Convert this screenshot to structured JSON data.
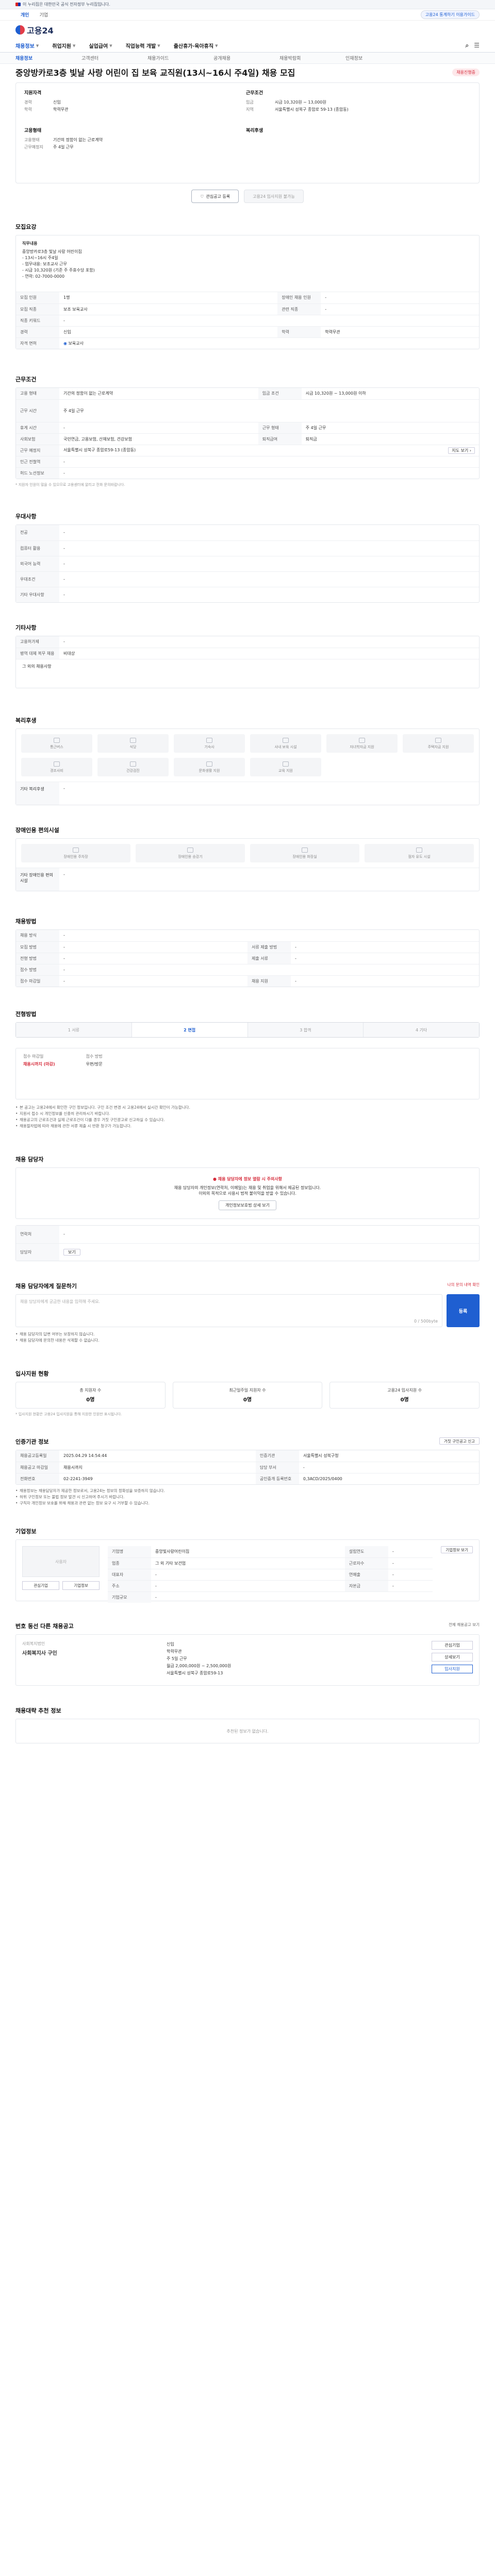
{
  "gov_strip": "이 누리집은 대한민국 공식 전자정부 누리집입니다.",
  "util": {
    "tabs": [
      "개인",
      "기업"
    ],
    "right": [
      "고용24 통계하기 이용가이드"
    ]
  },
  "header": {
    "logo_text": "고용24"
  },
  "gnb": {
    "items": [
      "채용정보",
      "취업지원",
      "실업급여",
      "직업능력 개발",
      "출산휴가·육아휴직"
    ],
    "active": 0
  },
  "subnav": [
    "채용정보",
    "고객센터",
    "채용가이드",
    "공개채용",
    "채용박람회",
    "인재정보"
  ],
  "title": "중앙방카로3층 빛날 사랑 어린이 집 보육 교직원(13시~16시 주4일) 채용 모집",
  "title_badge": "채용진행중",
  "summary": {
    "left_title": "지원자격",
    "left": [
      {
        "k": "경력",
        "v": "신입"
      },
      {
        "k": "학력",
        "v": "학력무관"
      }
    ],
    "left2_title": "고용형태",
    "left2": [
      {
        "k": "고용형태",
        "v": "기간의 정함이 없는 근로계약"
      },
      {
        "k": "근무예정지",
        "v": "주 4일 근무"
      }
    ],
    "right_title": "근무조건",
    "right": [
      {
        "k": "임금",
        "v": "시급 10,320원 ~ 13,000원"
      },
      {
        "k": "지역",
        "v": "서울특별시 성북구 종암로 59-13 (종암동)"
      }
    ],
    "right2_title": "복리후생",
    "right2": []
  },
  "buttons": {
    "save": "관심공고 등록",
    "apply": "고용24 입사지원 불가능"
  },
  "sec_recruit": {
    "title": "모집요강",
    "job_title": "직무내용",
    "job_lines": [
      "중앙방카로3층 빛날 사랑 어린이집",
      "- 13시~16시 주4일",
      "- 업무내용: 보조교사 근무",
      "- 시급 10,320원 (기준 주 주휴수당 포함)",
      "- 연락: 02-7000-0000"
    ],
    "rows": [
      [
        "모집 인원",
        "1명",
        "장애인 채용 인원",
        "-"
      ],
      [
        "모집 직종",
        "보조 보육교사",
        "관련 직종",
        "-"
      ],
      [
        "직종 키워드",
        "-",
        "",
        ""
      ],
      [
        "경력",
        "신입",
        "학력",
        "학력무관"
      ],
      [
        "자격 면허",
        "보육교사",
        "",
        ""
      ]
    ]
  },
  "sec_work": {
    "title": "근무조건",
    "rows": [
      [
        "고용 형태",
        "기간의 정함이 없는 근로계약",
        "임금 조건",
        "시급 10,320원 ~ 13,000원 이하"
      ],
      [
        "근무 시간",
        "주 4일 근무",
        "",
        ""
      ],
      [
        "휴게 시간",
        "-",
        "근무 형태",
        "주 4일 근무"
      ],
      [
        "사회보험",
        "국민연금, 고용보험, 산재보험, 건강보험",
        "퇴직급여",
        "퇴직금"
      ],
      [
        "근무 예정지",
        "서울특별시 성북구 종암로59-13 (종암동)",
        "",
        ""
      ],
      [
        "인근 전철역",
        "-",
        "",
        ""
      ],
      [
        "허드 노선정보",
        "-",
        "",
        ""
      ]
    ],
    "note": "* 지원자 인원이 많을 수 있으므로 고용센터에 알리고 전화 문의바랍니다."
  },
  "sec_pref": {
    "title": "우대사항",
    "rows": [
      [
        "전공",
        "-"
      ],
      [
        "컴퓨터 활용",
        "-"
      ],
      [
        "외국어 능력",
        "-"
      ],
      [
        "우대조건",
        "-"
      ],
      [
        "기타 우대사항",
        "-"
      ]
    ]
  },
  "sec_etc": {
    "title": "기타사항",
    "rows": [
      [
        "고용허가제",
        "-"
      ],
      [
        "병역 대체 복무 채용",
        "비대상"
      ]
    ],
    "link": "그 외의 채용사항"
  },
  "sec_welfare": {
    "title": "복리후생",
    "items": [
      "통근버스",
      "식당",
      "기숙사",
      "사내 보육 시설",
      "자녀학자금 지원",
      "주택자금 지원",
      "경조사비",
      "건강검진",
      "문화생활 지원",
      "교육 지원",
      "",
      ""
    ],
    "etc": "기타 복리후생",
    "etc_val": "-"
  },
  "sec_disabled": {
    "title": "장애인용 편의시설",
    "items": [
      "장애인용 주차장",
      "장애인용 승강기",
      "장애인용 화장실",
      "점자 유도 시설"
    ],
    "etc": "기타 장애인용 편의시설",
    "etc_val": "-"
  },
  "sec_apply": {
    "title": "채용방법",
    "rows": [
      [
        "채용 방식",
        "-",
        "",
        ""
      ],
      [
        "모집 방법",
        "-",
        "서류 제출 방법",
        "-"
      ],
      [
        "전형 방법",
        "-",
        "제출 서류",
        "-"
      ],
      [
        "접수 방법",
        "-",
        "",
        ""
      ],
      [
        "접수 마감일",
        "-",
        "채용 지원",
        "-"
      ]
    ]
  },
  "sec_steps": {
    "title": "전형방법",
    "steps": [
      "1 서류",
      "2 면접",
      "3 합격",
      "4 기타"
    ],
    "active": 1,
    "info": [
      [
        "접수 마감일",
        "채용시까지 (마감)"
      ],
      [
        "접수 방법",
        "우편/방문"
      ]
    ],
    "bullets": [
      "본 공고는 고용24에서 확인한 구인 정보입니다. 구인 조건 변경 시 고용24에서 실시간 확인이 가능합니다.",
      "지원서 접수 시 개인정보를 신중히 관리하시기 바랍니다.",
      "채용공고의 근로조건과 실제 근로조건이 다를 경우 거짓 구인광고로 신고하실 수 있습니다.",
      "채용절차법에 따라 채용에 관한 서류 제출 시 반환 청구가 가능합니다."
    ]
  },
  "sec_contact": {
    "title": "채용 담당자",
    "notice_title": "채용 담당자에 정보 열람 시 주의사항",
    "notice_lines": [
      "채용 담당자의 개인정보(연락처, 이메일)는 채용 및 취업을 위해서 제공된 정보입니다.",
      "이외의 목적으로 사용시 법적 불이익을 받을 수 있습니다."
    ],
    "notice_btn": "개인정보보호법 상세 보기",
    "rows": [
      [
        "연락처",
        "-"
      ],
      [
        "담당자",
        "-"
      ]
    ],
    "contact_btn": "보기"
  },
  "sec_qna": {
    "title": "채용 담당자에게 질문하기",
    "link": "나의 문의 내역 확인",
    "placeholder": "채용 담당자에게 궁금한 내용을 입력해 주세요.",
    "counter": "0 / 500byte",
    "submit": "등록",
    "notes": [
      "채용 담당자의 답변 여부는 보장하지 않습니다.",
      "채용 담당자에 문의한 내용은 삭제할 수 없습니다."
    ]
  },
  "sec_stats": {
    "title": "입사지원 현황",
    "cards": [
      [
        "총 지원자 수",
        "0명"
      ],
      [
        "최근일주일 지원자 수",
        "0명"
      ],
      [
        "고용24 입사지원 수",
        "0명"
      ]
    ],
    "note": "* 입사지원 현황은 고용24 입사지원을 통해 지원한 인원만 표시됩니다."
  },
  "sec_agency": {
    "title": "인증기관 정보",
    "rows": [
      [
        "채용공고등록일",
        "2025.04.29 14:54:44",
        "인증기관",
        "서울특별시 성북구청"
      ],
      [
        "채용공고 마감일",
        "채용시까지",
        "담당 부서",
        "-"
      ],
      [
        "전화번호",
        "02-2241-3949",
        "공인중개 등록번호",
        "0,3ACD/2025/0400"
      ]
    ],
    "notes": [
      "채용정보는 채용담당자가 제공한 정보로서, 고용24는 정보의 정확성을 보증하지 않습니다.",
      "허위 구인정보 또는 불법 정보 발견 시 신고하여 주시기 바랍니다.",
      "구직자 개인정보 보호를 위해 채용과 관련 없는 정보 요구 시 거부할 수 있습니다."
    ],
    "report_btn": "거짓 구인공고 신고"
  },
  "sec_company": {
    "title": "기업정보",
    "logo_placeholder": "사용자",
    "btns": [
      "관심기업",
      "기업정보"
    ],
    "rows": [
      [
        "기업명",
        "중앙빛사랑어린이집",
        "설립연도",
        "-"
      ],
      [
        "업종",
        "그 외 기타 보건업",
        "근로자수",
        "-"
      ],
      [
        "대표자",
        "-",
        "연매출",
        "-"
      ],
      [
        "주소",
        "-",
        "자본금",
        "-"
      ],
      [
        "기업규모",
        "-",
        "",
        ""
      ]
    ],
    "more": "기업정보 보기"
  },
  "sec_similar": {
    "title": "번호 동선 다른 채용공고",
    "more": "전체 채용공고 보기",
    "company": "사회복지법인",
    "job": "사회복지사 구인",
    "meta": [
      "신입",
      "학력무관",
      "주 5일 근무",
      "월급 2,000,000원 ~ 2,500,000원",
      "서울특별시 성북구 종암로59-13"
    ],
    "btns": [
      "관심기업",
      "상세보기",
      "입사지원"
    ]
  },
  "sec_recommend": {
    "title": "채용대략 추천 정보",
    "empty": "추천된 정보가 없습니다."
  }
}
